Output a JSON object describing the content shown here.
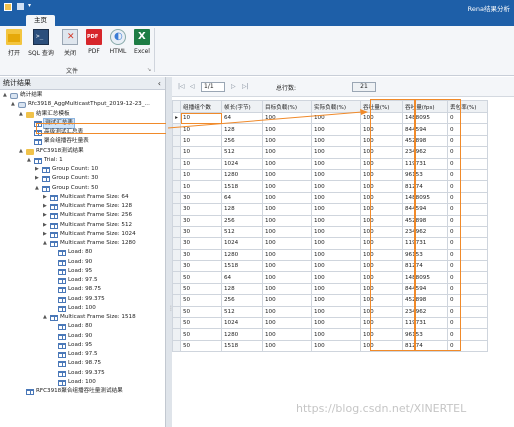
{
  "window": {
    "title": "Rena结果分析",
    "tab_home": "主页"
  },
  "ribbon": {
    "buttons": [
      {
        "label": "打开",
        "icon": "folder-open-icon"
      },
      {
        "label": "SQL 查询",
        "icon": "terminal-icon"
      },
      {
        "label": "关闭",
        "icon": "close-icon"
      },
      {
        "label": "PDF",
        "icon": "pdf-icon"
      },
      {
        "label": "HTML",
        "icon": "html-icon"
      },
      {
        "label": "Excel",
        "icon": "excel-icon"
      }
    ],
    "group_label": "文件",
    "launcher_glyph": "↘"
  },
  "left_panel": {
    "title": "统计结果",
    "collapse_glyph": "‹",
    "tree": [
      {
        "label": "统计结果",
        "icon": "db",
        "toggle": "▲"
      },
      {
        "label": "Rfc3918_AggMulticastThput_2019-12-23_...",
        "icon": "db",
        "toggle": "▲"
      },
      {
        "label": "结果汇总模板",
        "icon": "folder",
        "toggle": "▲"
      },
      {
        "label": "测试汇总表",
        "icon": "table",
        "toggle": "",
        "selected": true
      },
      {
        "label": "高级测试汇总表",
        "icon": "table",
        "toggle": ""
      },
      {
        "label": "聚合组播吞吐量表",
        "icon": "table",
        "toggle": ""
      },
      {
        "label": "RFC3918测试结果",
        "icon": "folder",
        "toggle": "▲"
      },
      {
        "label": "Trial: 1",
        "icon": "table",
        "toggle": "▲"
      },
      {
        "label": "Group Count: 10",
        "icon": "table",
        "toggle": "▶"
      },
      {
        "label": "Group Count: 30",
        "icon": "table",
        "toggle": "▶"
      },
      {
        "label": "Group Count: 50",
        "icon": "table",
        "toggle": "▲"
      },
      {
        "label": "Multicast Frame Size: 64",
        "icon": "table",
        "toggle": "▶"
      },
      {
        "label": "Multicast Frame Size: 128",
        "icon": "table",
        "toggle": "▶"
      },
      {
        "label": "Multicast Frame Size: 256",
        "icon": "table",
        "toggle": "▶"
      },
      {
        "label": "Multicast Frame Size: 512",
        "icon": "table",
        "toggle": "▶"
      },
      {
        "label": "Multicast Frame Size: 1024",
        "icon": "table",
        "toggle": "▶"
      },
      {
        "label": "Multicast Frame Size: 1280",
        "icon": "table",
        "toggle": "▲"
      },
      {
        "label": "Load: 80",
        "icon": "table",
        "toggle": ""
      },
      {
        "label": "Load: 90",
        "icon": "table",
        "toggle": ""
      },
      {
        "label": "Load: 95",
        "icon": "table",
        "toggle": ""
      },
      {
        "label": "Load: 97.5",
        "icon": "table",
        "toggle": ""
      },
      {
        "label": "Load: 98.75",
        "icon": "table",
        "toggle": ""
      },
      {
        "label": "Load: 99.375",
        "icon": "table",
        "toggle": ""
      },
      {
        "label": "Load: 100",
        "icon": "table",
        "toggle": ""
      },
      {
        "label": "Multicast Frame Size: 1518",
        "icon": "table",
        "toggle": "▲"
      },
      {
        "label": "Load: 80",
        "icon": "table",
        "toggle": ""
      },
      {
        "label": "Load: 90",
        "icon": "table",
        "toggle": ""
      },
      {
        "label": "Load: 95",
        "icon": "table",
        "toggle": ""
      },
      {
        "label": "Load: 97.5",
        "icon": "table",
        "toggle": ""
      },
      {
        "label": "Load: 98.75",
        "icon": "table",
        "toggle": ""
      },
      {
        "label": "Load: 99.375",
        "icon": "table",
        "toggle": ""
      },
      {
        "label": "Load: 100",
        "icon": "table",
        "toggle": ""
      },
      {
        "label": "RFC3918聚合组播吞吐量测试结果",
        "icon": "table",
        "toggle": ""
      }
    ]
  },
  "pager": {
    "first": "|◁",
    "prev": "◁",
    "page_value": "1/1",
    "next": "▷",
    "last": "▷|",
    "total_label": "总行数:",
    "total_value": "21"
  },
  "grid": {
    "columns": [
      "组播组个数",
      "帧长(字节)",
      "目标负载(%)",
      "实际负载(%)",
      "吞吐量(%)",
      "吞吐量(fps)",
      "丢包率(%)"
    ],
    "rows": [
      [
        "10",
        "64",
        "100",
        "100",
        "100",
        "1488095",
        "0"
      ],
      [
        "10",
        "128",
        "100",
        "100",
        "100",
        "844594",
        "0"
      ],
      [
        "10",
        "256",
        "100",
        "100",
        "100",
        "452898",
        "0"
      ],
      [
        "10",
        "512",
        "100",
        "100",
        "100",
        "234962",
        "0"
      ],
      [
        "10",
        "1024",
        "100",
        "100",
        "100",
        "119731",
        "0"
      ],
      [
        "10",
        "1280",
        "100",
        "100",
        "100",
        "96153",
        "0"
      ],
      [
        "10",
        "1518",
        "100",
        "100",
        "100",
        "81274",
        "0"
      ],
      [
        "30",
        "64",
        "100",
        "100",
        "100",
        "1488095",
        "0"
      ],
      [
        "30",
        "128",
        "100",
        "100",
        "100",
        "844594",
        "0"
      ],
      [
        "30",
        "256",
        "100",
        "100",
        "100",
        "452898",
        "0"
      ],
      [
        "30",
        "512",
        "100",
        "100",
        "100",
        "234962",
        "0"
      ],
      [
        "30",
        "1024",
        "100",
        "100",
        "100",
        "119731",
        "0"
      ],
      [
        "30",
        "1280",
        "100",
        "100",
        "100",
        "96153",
        "0"
      ],
      [
        "30",
        "1518",
        "100",
        "100",
        "100",
        "81274",
        "0"
      ],
      [
        "50",
        "64",
        "100",
        "100",
        "100",
        "1488095",
        "0"
      ],
      [
        "50",
        "128",
        "100",
        "100",
        "100",
        "844594",
        "0"
      ],
      [
        "50",
        "256",
        "100",
        "100",
        "100",
        "452898",
        "0"
      ],
      [
        "50",
        "512",
        "100",
        "100",
        "100",
        "234962",
        "0"
      ],
      [
        "50",
        "1024",
        "100",
        "100",
        "100",
        "119731",
        "0"
      ],
      [
        "50",
        "1280",
        "100",
        "100",
        "100",
        "96153",
        "0"
      ],
      [
        "50",
        "1518",
        "100",
        "100",
        "100",
        "81274",
        "0"
      ]
    ],
    "row_indicator": "▸"
  },
  "watermark": "https://blog.csdn.net/XINERTEL",
  "colors": {
    "titlebar": "#1e5fa8",
    "highlight": "#f08a2a",
    "selection": "#cfe3f8"
  }
}
